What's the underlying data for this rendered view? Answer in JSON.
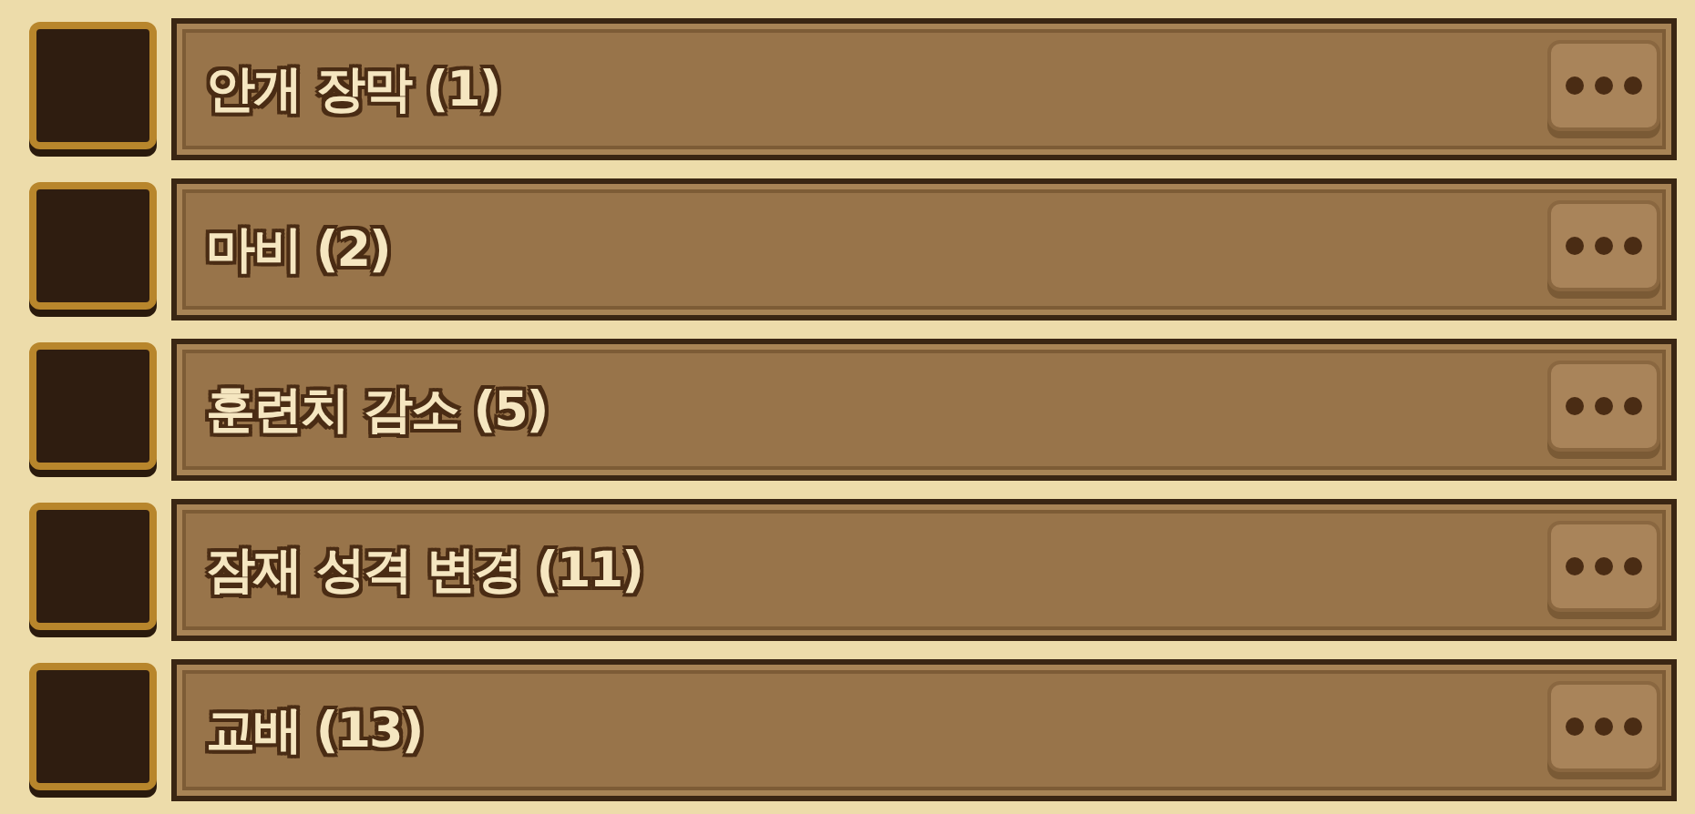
{
  "items": [
    {
      "label": "안개 장막 (1)"
    },
    {
      "label": "마비 (2)"
    },
    {
      "label": "훈련치 감소 (5)"
    },
    {
      "label": "잠재 성격 변경 (11)"
    },
    {
      "label": "교배 (13)"
    }
  ]
}
